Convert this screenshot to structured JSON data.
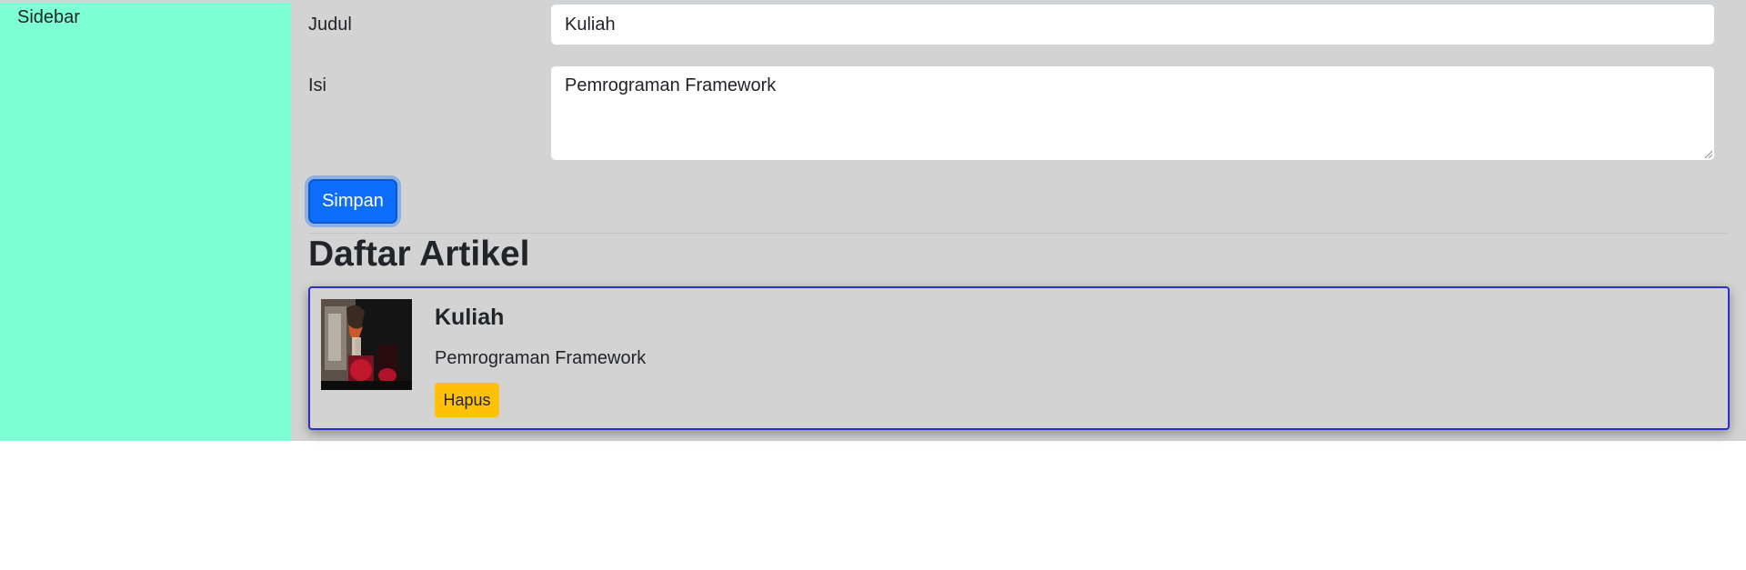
{
  "sidebar": {
    "label": "Sidebar",
    "color": "#7fffd4"
  },
  "form": {
    "title_label": "Judul",
    "title_value": "Kuliah",
    "content_label": "Isi",
    "content_value": "Pemrograman Framework",
    "submit_label": "Simpan",
    "submit_color": "#0d6efd"
  },
  "articles": {
    "heading": "Daftar Artikel",
    "items": [
      {
        "title": "Kuliah",
        "body": "Pemrograman Framework",
        "delete_label": "Hapus",
        "delete_color": "#ffc107",
        "thumbnail_icon": "photo-thumbnail"
      }
    ]
  },
  "colors": {
    "main_background": "#d3d3d3",
    "card_border": "#2d2dc8"
  }
}
